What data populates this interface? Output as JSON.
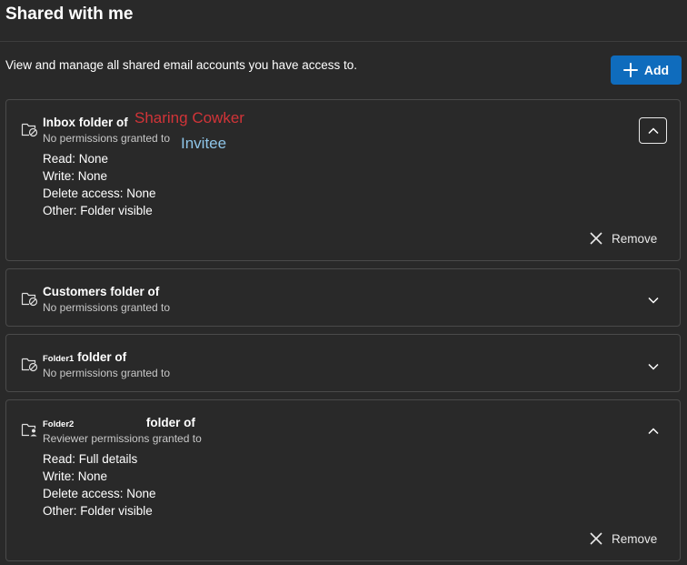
{
  "header": {
    "title": "Shared with me",
    "description": "View and manage all shared email accounts you have access to.",
    "add_label": "Add"
  },
  "colors": {
    "background": "#292929",
    "accent": "#0f6cbd",
    "annotation_red": "#d13438",
    "annotation_blue": "#8ec5e8"
  },
  "annotations": {
    "owner": "Sharing Cowker",
    "invitee": "Invitee"
  },
  "cards": [
    {
      "title": "Inbox folder of",
      "subtitle": "No permissions granted to",
      "icon": "folder-blocked-icon",
      "expanded": true,
      "permissions": {
        "read": "Read: None",
        "write": "Write: None",
        "delete": "Delete access: None",
        "other": "Other: Folder visible"
      },
      "remove_label": "Remove"
    },
    {
      "title": "Customers folder of",
      "subtitle": "No permissions granted to",
      "icon": "folder-blocked-icon",
      "expanded": false
    },
    {
      "folder_name": "Folder1",
      "title": "folder of",
      "subtitle": "No permissions granted to",
      "icon": "folder-blocked-icon",
      "expanded": false
    },
    {
      "folder_name": "Folder2",
      "title": "folder of",
      "subtitle": "Reviewer permissions granted to",
      "icon": "folder-person-icon",
      "expanded": true,
      "permissions": {
        "read": "Read: Full details",
        "write": "Write: None",
        "delete": "Delete access: None",
        "other": "Other: Folder visible"
      },
      "remove_label": "Remove"
    }
  ]
}
